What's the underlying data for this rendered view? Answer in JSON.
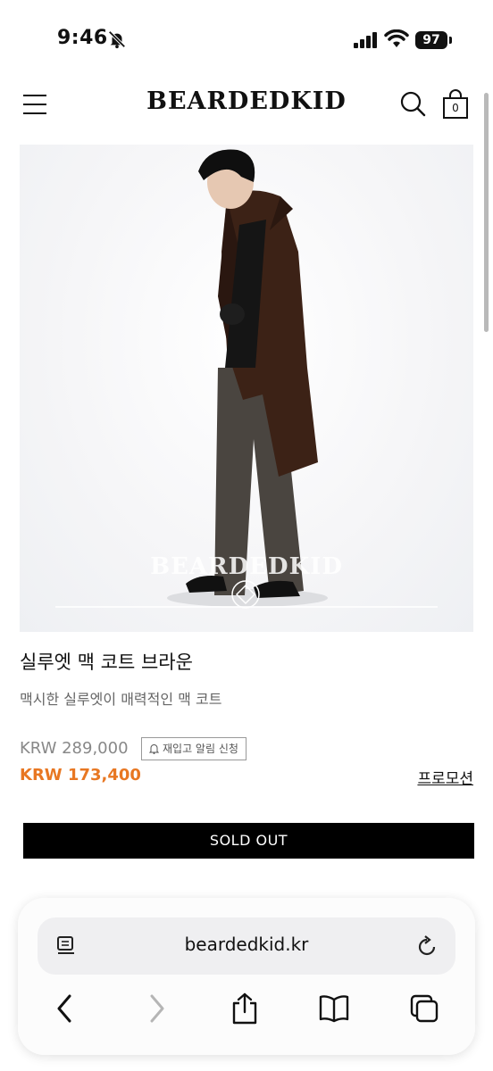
{
  "status_bar": {
    "time": "9:46",
    "battery": "97"
  },
  "header": {
    "logo": "BEARDEDKID",
    "cart_count": "0"
  },
  "product": {
    "image_watermark": "BEARDEDKID",
    "title": "실루엣 맥 코트 브라운",
    "subtitle": "맥시한 실루엣이 매력적인 맥 코트",
    "original_price": "KRW 289,000",
    "restock_label": "재입고 알림 신청",
    "sale_price": "KRW 173,400",
    "promotion_label": "프로모션",
    "sold_out_label": "SOLD OUT"
  },
  "browser": {
    "url": "beardedkid.kr"
  },
  "colors": {
    "sale_price": "#e87722",
    "button_bg": "#000000"
  }
}
